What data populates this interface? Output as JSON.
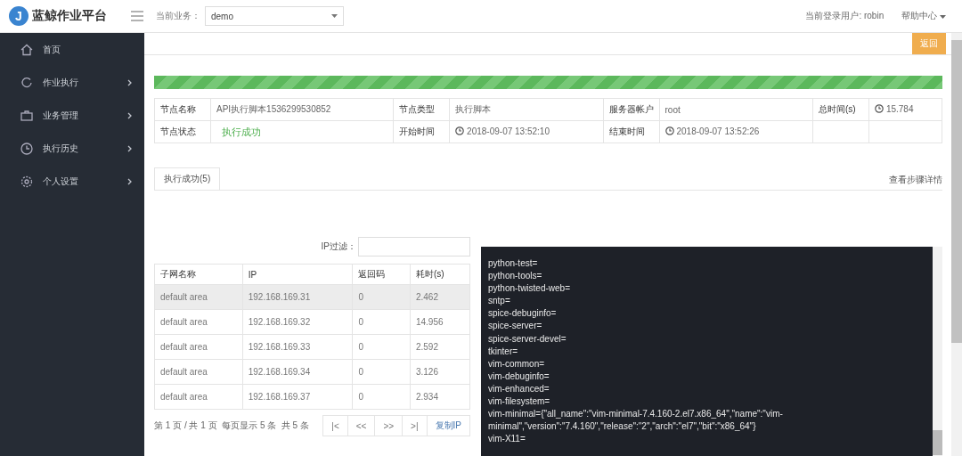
{
  "header": {
    "logo_letter": "J",
    "app_title": "蓝鲸作业平台",
    "business_label": "当前业务：",
    "business_select": "demo",
    "user": "当前登录用户: robin",
    "help_menu": "帮助中心"
  },
  "sidebar": {
    "items": [
      {
        "label": "首页"
      },
      {
        "label": "作业执行"
      },
      {
        "label": "业务管理"
      },
      {
        "label": "执行历史"
      },
      {
        "label": "个人设置"
      }
    ]
  },
  "toolbar": {
    "back_button": "返回"
  },
  "progress": {
    "level": 1
  },
  "node_info": {
    "rows": [
      [
        {
          "label": "节点名称",
          "value": "API执行脚本1536299530852",
          "kind": "text"
        },
        {
          "label": "节点类型",
          "value": "执行脚本",
          "kind": "text"
        },
        {
          "label": "服务器帐户",
          "value": "root",
          "kind": "text"
        },
        {
          "label": "总时间(s)",
          "value": "15.784",
          "kind": "time"
        }
      ],
      [
        {
          "label": "节点状态",
          "value": "执行成功",
          "kind": "success"
        },
        {
          "label": "开始时间",
          "value": "2018-09-07 13:52:10",
          "kind": "time"
        },
        {
          "label": "结束时间",
          "value": "2018-09-07 13:52:26",
          "kind": "time"
        },
        {
          "kind": "empty"
        }
      ]
    ]
  },
  "tabs": [
    {
      "label": "执行成功(5)",
      "selected": true
    }
  ],
  "step_link": "查看步骤详情",
  "ip_filter": {
    "label": "IP过滤："
  },
  "hosts_table": {
    "columns": [
      "子网名称",
      "IP",
      "返回码",
      "耗时(s)"
    ],
    "rows": [
      {
        "cells": [
          "default area",
          "192.168.169.31",
          "0",
          "2.462"
        ],
        "selected": true
      },
      {
        "cells": [
          "default area",
          "192.168.169.32",
          "0",
          "14.956"
        ],
        "selected": false
      },
      {
        "cells": [
          "default area",
          "192.168.169.33",
          "0",
          "2.592"
        ],
        "selected": false
      },
      {
        "cells": [
          "default area",
          "192.168.169.34",
          "0",
          "3.126"
        ],
        "selected": false
      },
      {
        "cells": [
          "default area",
          "192.168.169.37",
          "0",
          "2.934"
        ],
        "selected": false
      }
    ]
  },
  "pagination": {
    "summary": "第 1 页 / 共 1 页  每页显示 5 条  共 5 条",
    "buttons": [
      "|<",
      "<<",
      ">>",
      ">|"
    ],
    "copy_button": "复制IP"
  },
  "log": {
    "lines": [
      "python-test=",
      "python-tools=",
      "python-twisted-web=",
      "sntp=",
      "spice-debuginfo=",
      "spice-server=",
      "spice-server-devel=",
      "tkinter=",
      "vim-common=",
      "vim-debuginfo=",
      "vim-enhanced=",
      "vim-filesystem=",
      "vim-minimal={\"all_name\":\"vim-minimal-7.4.160-2.el7.x86_64\",\"name\":\"vim-minimal\",\"version\":\"7.4.160\",\"release\":\"2\",\"arch\":\"el7\",\"bit\":\"x86_64\"}",
      "vim-X11="
    ]
  }
}
